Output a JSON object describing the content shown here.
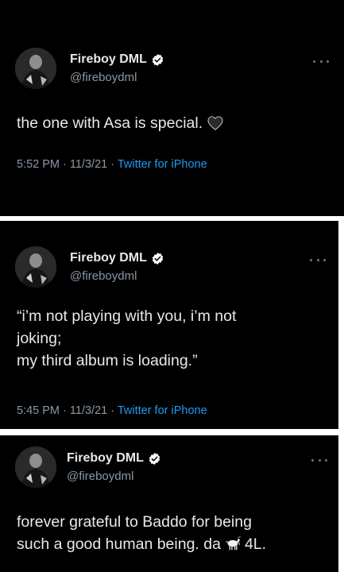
{
  "tweets": [
    {
      "name": "Fireboy DML",
      "handle": "@fireboydml",
      "text": "the one with Asa is special.",
      "emoji": "black-heart-icon",
      "time": "5:52 PM",
      "date": "11/3/21",
      "source": "Twitter for iPhone"
    },
    {
      "name": "Fireboy DML",
      "handle": "@fireboydml",
      "text_lines": [
        "“i’m not playing with you, i’m not",
        "joking;",
        "my third album is loading.”"
      ],
      "time": "5:45 PM",
      "date": "11/3/21",
      "source": "Twitter for iPhone"
    },
    {
      "name": "Fireboy DML",
      "handle": "@fireboydml",
      "text_line1": "forever grateful to Baddo for being",
      "text_line2_before": "such a good human being. da",
      "emoji": "goat-icon",
      "text_line2_after": "4L."
    }
  ],
  "separator": " · ",
  "colors": {
    "background": "#000000",
    "text": "#e7e9ea",
    "secondary": "#8b98a5",
    "link": "#1d9bf0",
    "verified": "#ffffff"
  }
}
